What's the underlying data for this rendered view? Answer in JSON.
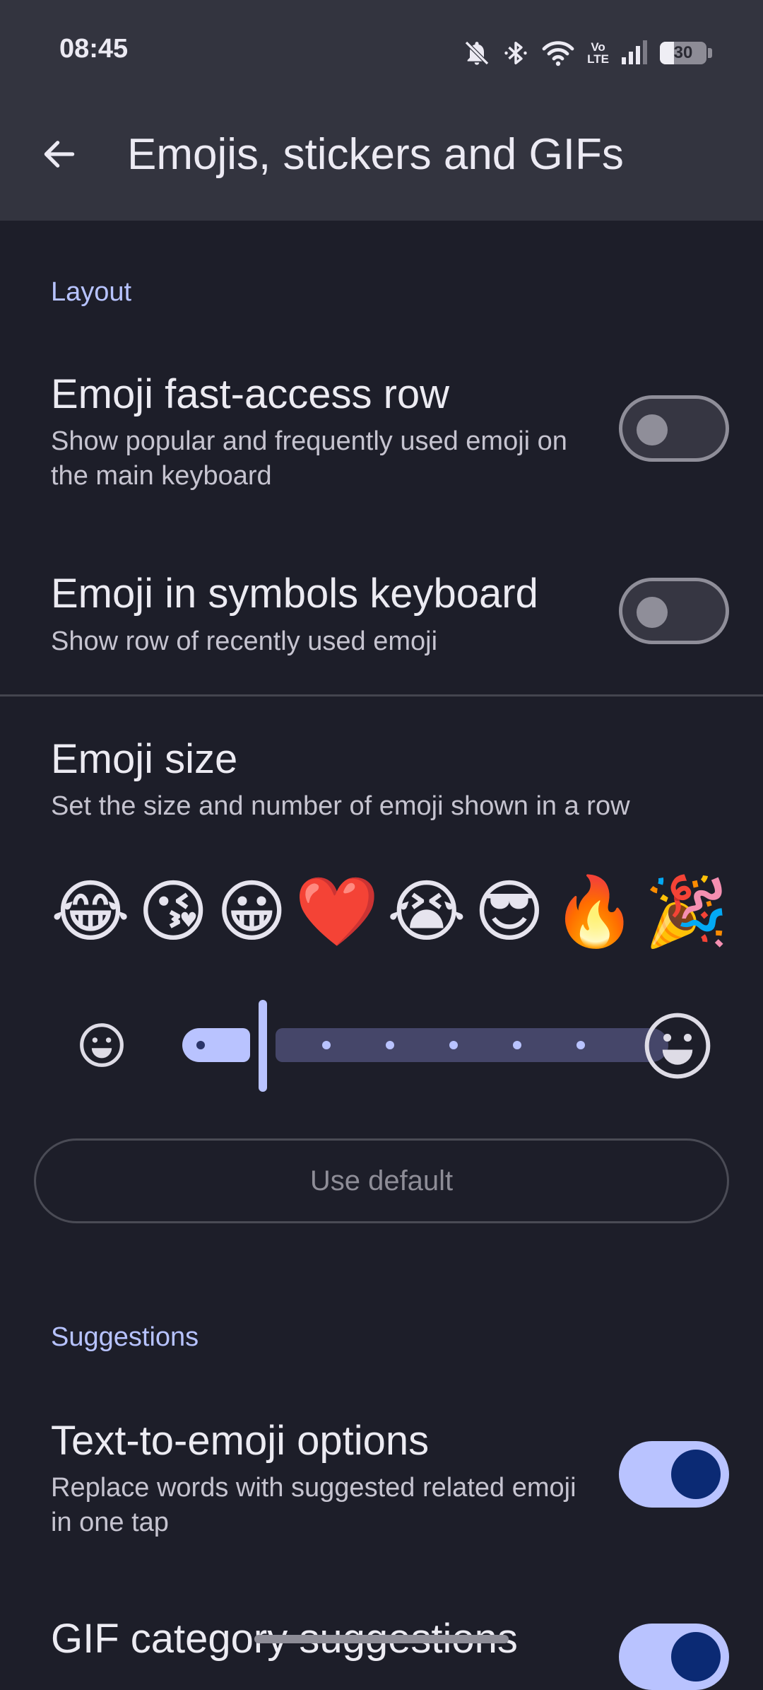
{
  "status_bar": {
    "time": "08:45",
    "battery_level": "30",
    "icons": [
      "bell-off-icon",
      "bluetooth-icon",
      "wifi-icon",
      "volte-icon",
      "signal-icon",
      "battery-icon"
    ],
    "volte_label_top": "Vo",
    "volte_label_bottom": "LTE"
  },
  "app_bar": {
    "title": "Emojis, stickers and GIFs",
    "back_icon": "arrow-back-icon"
  },
  "sections": {
    "layout": {
      "header": "Layout",
      "fast_access": {
        "title": "Emoji fast-access row",
        "summary": "Show popular and frequently used emoji on the main keyboard",
        "enabled": false
      },
      "symbols_keyboard": {
        "title": "Emoji in symbols keyboard",
        "summary": "Show row of recently used emoji",
        "enabled": false
      },
      "emoji_size": {
        "title": "Emoji size",
        "summary": "Set the size and number of emoji shown in a row",
        "preview": [
          "😂",
          "😘",
          "😀",
          "❤️",
          "😭",
          "😎",
          "🔥",
          "🎉"
        ],
        "slider_steps": 7,
        "slider_position": 1,
        "default_button": "Use default"
      }
    },
    "suggestions": {
      "header": "Suggestions",
      "text_to_emoji": {
        "title": "Text-to-emoji options",
        "summary": "Replace words with suggested related emoji in one tap",
        "enabled": true
      },
      "gif_category": {
        "title": "GIF category suggestions",
        "enabled": true
      }
    }
  },
  "colors": {
    "background": "#1d1e29",
    "app_bar": "#33343f",
    "accent": "#b9c3ff",
    "switch_thumb_on": "#0b2a74"
  }
}
